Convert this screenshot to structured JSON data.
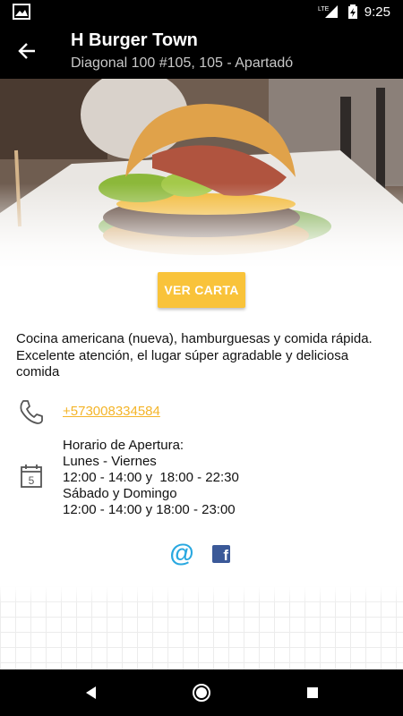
{
  "status_bar": {
    "time": "9:25",
    "network": "LTE"
  },
  "app_bar": {
    "title": "H Burger Town",
    "subtitle": "Diagonal 100 #105, 105 - Apartadó"
  },
  "actions": {
    "ver_carta_label": "VER CARTA"
  },
  "description": "Cocina americana (nueva), hamburguesas y comida rápida. Excelente atención, el lugar súper agradable y deliciosa comida",
  "contact": {
    "phone": "+573008334584"
  },
  "hours": {
    "heading": "Horario de Apertura:",
    "weekday_label": "Lunes - Viernes",
    "weekday_hours": "12:00 - 14:00 y  18:00 - 22:30",
    "weekend_label": "Sábado y Domingo",
    "weekend_hours": "12:00 - 14:00 y 18:00 - 23:00",
    "calendar_day": "5"
  },
  "social": {
    "email_glyph": "@",
    "facebook_glyph": "f"
  },
  "colors": {
    "accent": "#f9c33a",
    "link": "#f4b52a",
    "email": "#29a8e0",
    "facebook": "#3b5998"
  },
  "icons": [
    "back-arrow-icon",
    "phone-icon",
    "calendar-icon",
    "email-icon",
    "facebook-icon",
    "nav-back-icon",
    "nav-home-icon",
    "nav-recents-icon"
  ]
}
